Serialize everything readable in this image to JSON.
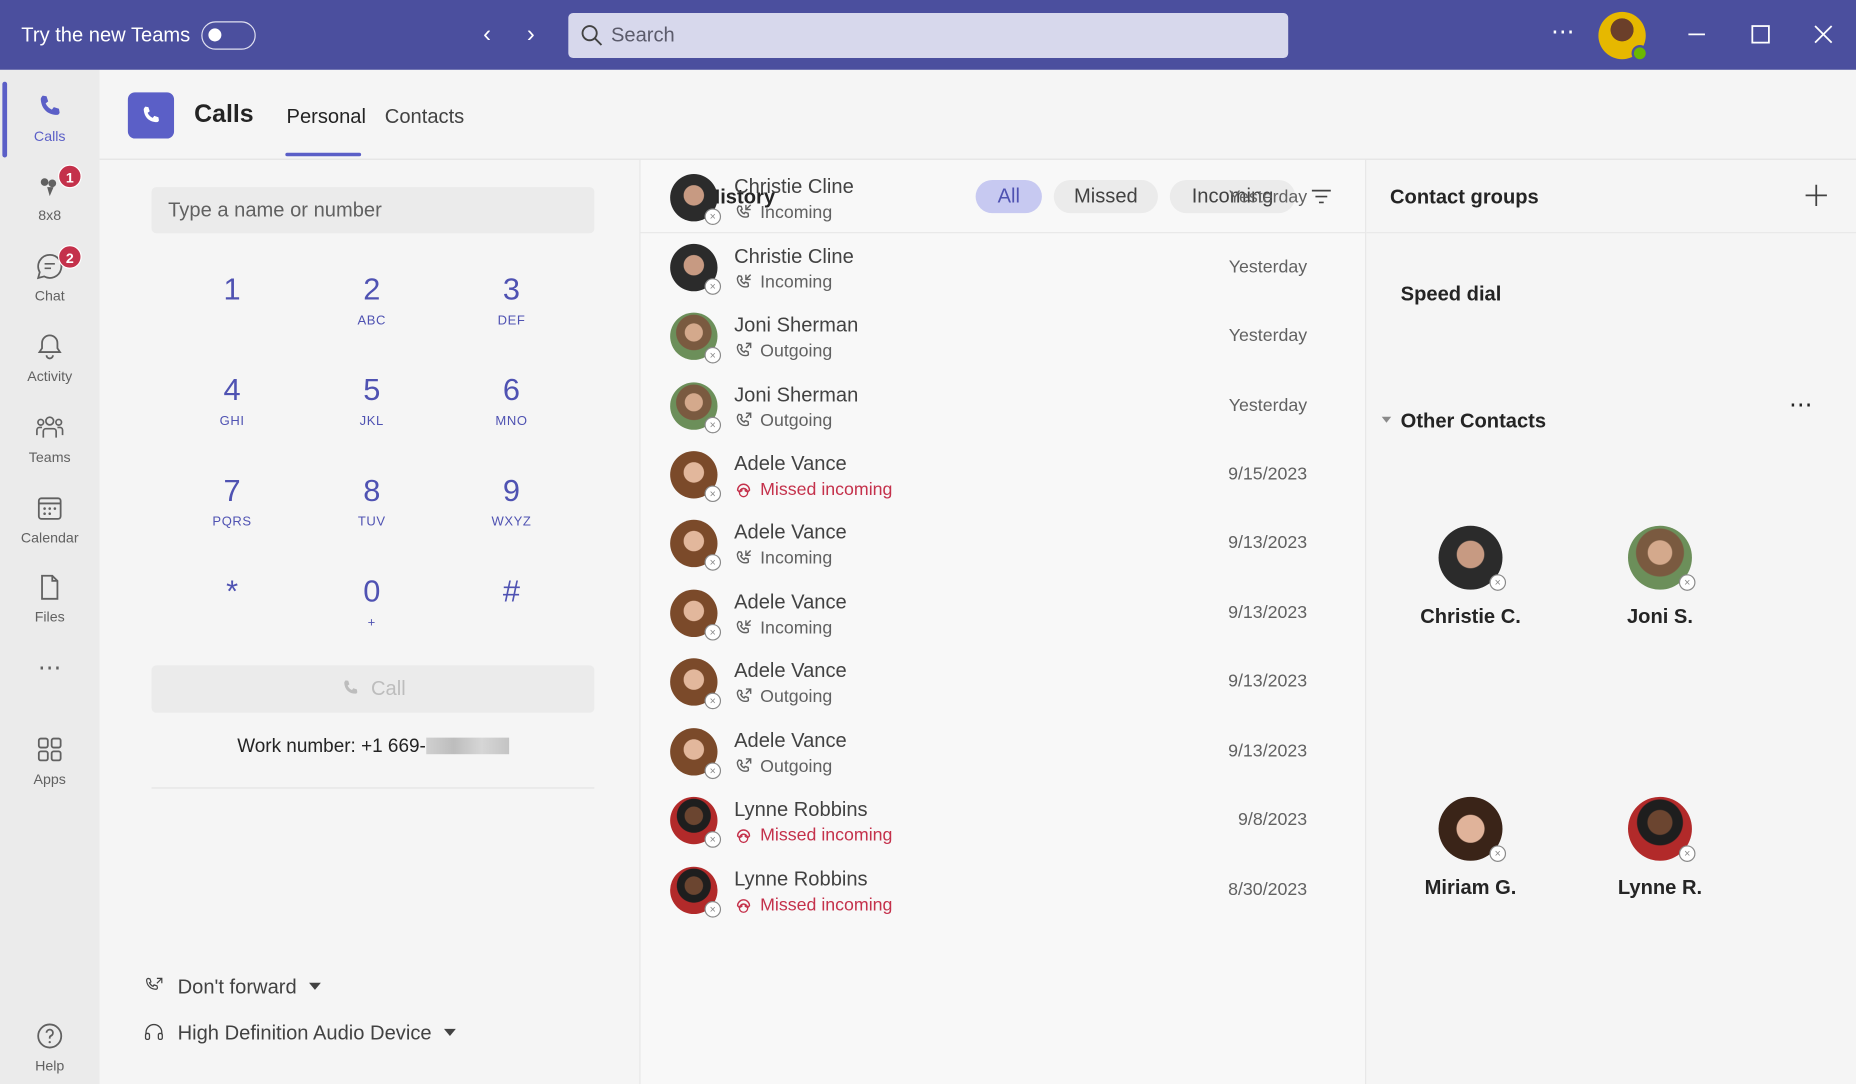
{
  "titlebar": {
    "title": "Try the new Teams",
    "search_placeholder": "Search",
    "more": "⋯"
  },
  "rail": {
    "items": [
      {
        "label": "Calls",
        "icon": "phone-icon",
        "active": true
      },
      {
        "label": "8x8",
        "icon": "8x8-icon",
        "badge": "1"
      },
      {
        "label": "Chat",
        "icon": "chat-icon",
        "badge": "2"
      },
      {
        "label": "Activity",
        "icon": "bell-icon"
      },
      {
        "label": "Teams",
        "icon": "teams-icon"
      },
      {
        "label": "Calendar",
        "icon": "calendar-icon"
      },
      {
        "label": "Files",
        "icon": "file-icon"
      },
      {
        "label": "⋯",
        "icon": "more-apps-icon"
      },
      {
        "label": "Apps",
        "icon": "apps-icon"
      },
      {
        "label": "Help",
        "icon": "help-icon"
      }
    ]
  },
  "header": {
    "title": "Calls",
    "tabs": [
      "Personal",
      "Contacts"
    ],
    "active_tab": "Personal"
  },
  "dialpad": {
    "placeholder": "Type a name or number",
    "keys": [
      {
        "digit": "1",
        "letters": ""
      },
      {
        "digit": "2",
        "letters": "ABC"
      },
      {
        "digit": "3",
        "letters": "DEF"
      },
      {
        "digit": "4",
        "letters": "GHI"
      },
      {
        "digit": "5",
        "letters": "JKL"
      },
      {
        "digit": "6",
        "letters": "MNO"
      },
      {
        "digit": "7",
        "letters": "PQRS"
      },
      {
        "digit": "8",
        "letters": "TUV"
      },
      {
        "digit": "9",
        "letters": "WXYZ"
      },
      {
        "digit": "*",
        "letters": ""
      },
      {
        "digit": "0",
        "letters": "+"
      },
      {
        "digit": "#",
        "letters": ""
      }
    ],
    "call_label": "Call",
    "work_number": "Work number: +1 669-",
    "forward_label": "Don't forward",
    "device_label": "High Definition Audio Device"
  },
  "history": {
    "title": "History",
    "filters": [
      "All",
      "Missed",
      "Incoming"
    ],
    "active_filter": "All",
    "rows": [
      {
        "name": "Christie Cline",
        "type": "Incoming",
        "date": "Yesterday",
        "missed": false
      },
      {
        "name": "Christie Cline",
        "type": "Incoming",
        "date": "Yesterday",
        "missed": false
      },
      {
        "name": "Joni Sherman",
        "type": "Outgoing",
        "date": "Yesterday",
        "missed": false
      },
      {
        "name": "Joni Sherman",
        "type": "Outgoing",
        "date": "Yesterday",
        "missed": false
      },
      {
        "name": "Adele Vance",
        "type": "Missed incoming",
        "date": "9/15/2023",
        "missed": true
      },
      {
        "name": "Adele Vance",
        "type": "Incoming",
        "date": "9/13/2023",
        "missed": false
      },
      {
        "name": "Adele Vance",
        "type": "Incoming",
        "date": "9/13/2023",
        "missed": false
      },
      {
        "name": "Adele Vance",
        "type": "Outgoing",
        "date": "9/13/2023",
        "missed": false
      },
      {
        "name": "Adele Vance",
        "type": "Outgoing",
        "date": "9/13/2023",
        "missed": false
      },
      {
        "name": "Lynne Robbins",
        "type": "Missed incoming",
        "date": "9/8/2023",
        "missed": true
      },
      {
        "name": "Lynne Robbins",
        "type": "Missed incoming",
        "date": "8/30/2023",
        "missed": true
      }
    ]
  },
  "contacts": {
    "title": "Contact groups",
    "speed_dial": "Speed dial",
    "other_contacts": "Other Contacts",
    "more": "⋯",
    "people": [
      "Christie C.",
      "Joni S.",
      "Miriam G.",
      "Lynne R."
    ]
  },
  "colors": {
    "titlebar": "#4b4f9e",
    "accent": "#5b5fc7",
    "missed": "#c4314b",
    "badge": "#c4314b"
  }
}
